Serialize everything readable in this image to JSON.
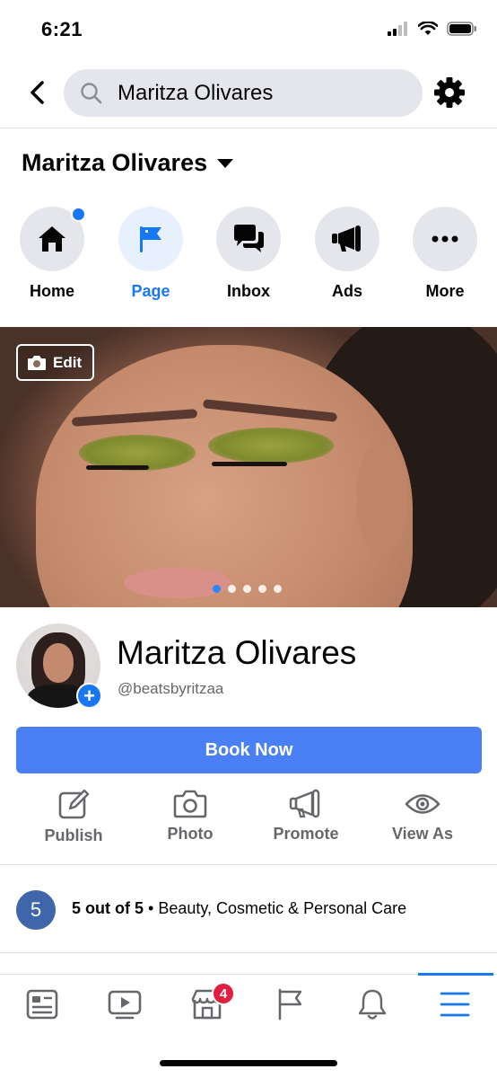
{
  "status_bar": {
    "time": "6:21"
  },
  "search": {
    "query": "Maritza Olivares"
  },
  "page_header": {
    "name": "Maritza Olivares"
  },
  "nav": {
    "items": [
      {
        "label": "Home",
        "icon": "home-icon"
      },
      {
        "label": "Page",
        "icon": "flag-icon"
      },
      {
        "label": "Inbox",
        "icon": "messages-icon"
      },
      {
        "label": "Ads",
        "icon": "megaphone-icon"
      },
      {
        "label": "More",
        "icon": "more-icon"
      }
    ],
    "active": "Page"
  },
  "cover": {
    "edit_label": "Edit",
    "slide_count": 5,
    "active_slide": 1
  },
  "profile": {
    "name": "Maritza Olivares",
    "handle": "@beatsbyritzaa"
  },
  "cta": {
    "label": "Book Now"
  },
  "actions": [
    {
      "label": "Publish",
      "icon": "edit-icon"
    },
    {
      "label": "Photo",
      "icon": "camera-icon"
    },
    {
      "label": "Promote",
      "icon": "megaphone-icon"
    },
    {
      "label": "View As",
      "icon": "eye-icon"
    }
  ],
  "rating": {
    "badge": "5",
    "score": "5 out of 5",
    "separator": "•",
    "category": "Beauty, Cosmetic & Personal Care"
  },
  "tabbar": {
    "items": [
      {
        "icon": "news-feed-icon"
      },
      {
        "icon": "watch-icon"
      },
      {
        "icon": "marketplace-icon",
        "badge": "4"
      },
      {
        "icon": "pages-flag-icon"
      },
      {
        "icon": "bell-icon"
      },
      {
        "icon": "menu-icon"
      }
    ],
    "active_index": 5
  },
  "colors": {
    "accent": "#1877f2",
    "cta": "#4a7ff5",
    "badge": "#e41e3f",
    "rating": "#3f65ab"
  }
}
